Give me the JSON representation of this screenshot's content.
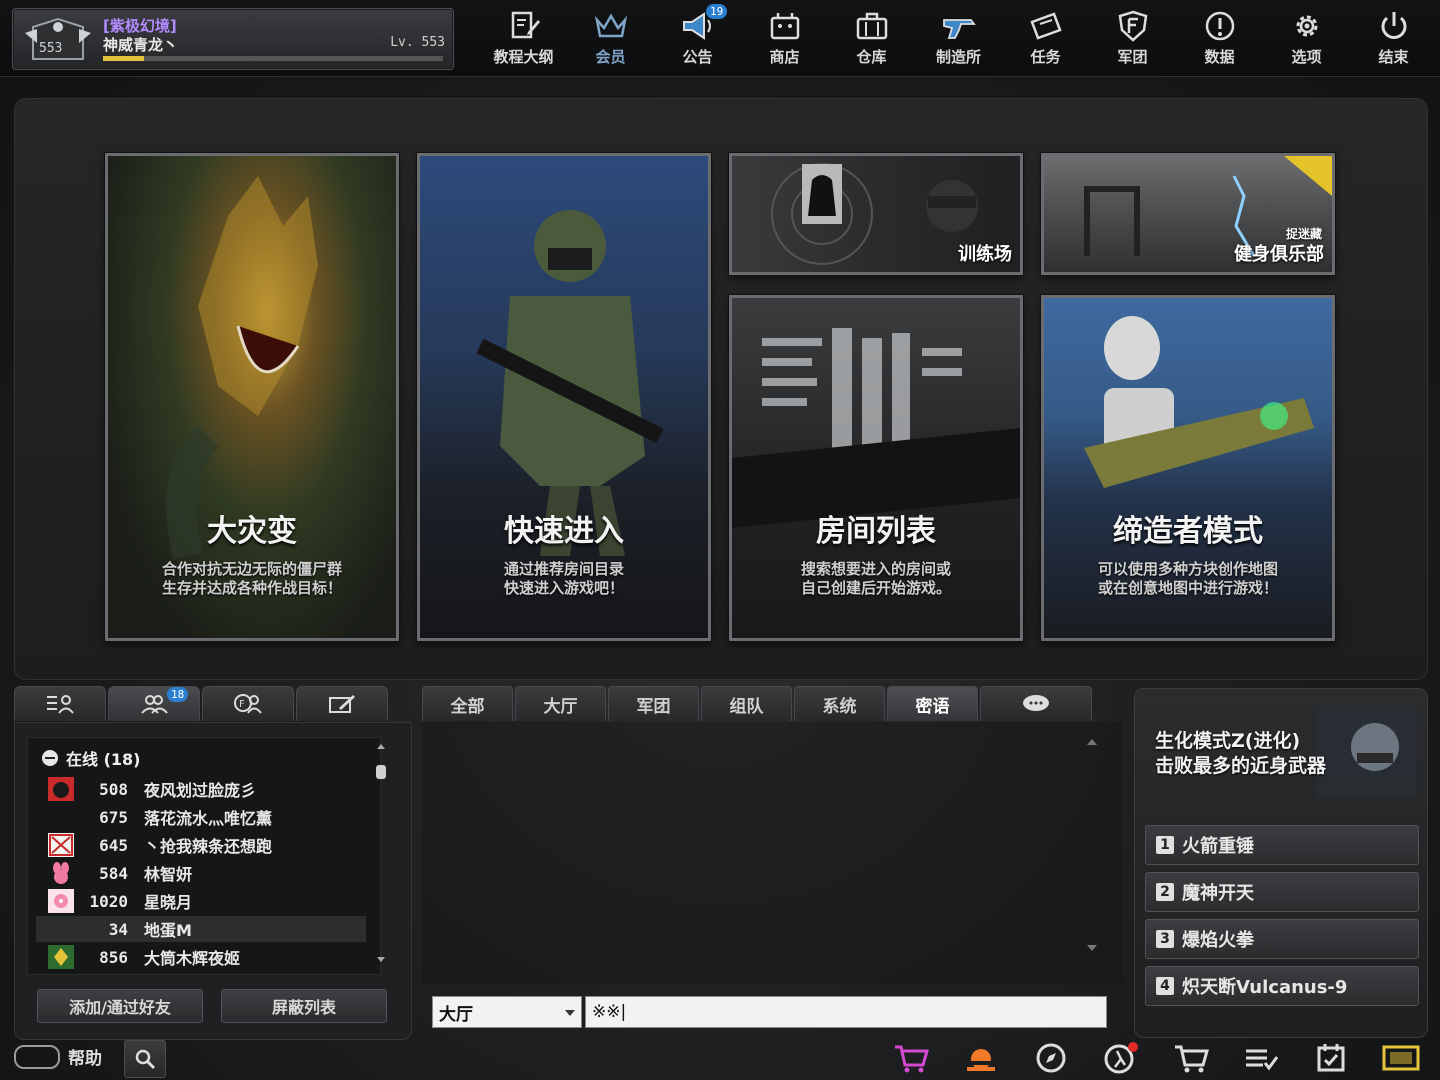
{
  "profile": {
    "rank_number": "553",
    "clan_tag": "[紫极幻境]",
    "name": "神威青龙丶",
    "level": "Lv. 553",
    "xp_progress": 0.12
  },
  "menu": [
    {
      "label": "教程大纲",
      "icon": "notebook-edit-icon"
    },
    {
      "label": "会员",
      "icon": "crown-icon"
    },
    {
      "label": "公告",
      "icon": "megaphone-icon",
      "badge": "19"
    },
    {
      "label": "商店",
      "icon": "store-icon"
    },
    {
      "label": "仓库",
      "icon": "briefcase-icon"
    },
    {
      "label": "制造所",
      "icon": "gun-icon"
    },
    {
      "label": "任务",
      "icon": "ticket-icon"
    },
    {
      "label": "军团",
      "icon": "clan-shield-icon"
    },
    {
      "label": "数据",
      "icon": "info-icon"
    },
    {
      "label": "选项",
      "icon": "gear-icon"
    },
    {
      "label": "结束",
      "icon": "power-icon"
    }
  ],
  "cards": {
    "disaster": {
      "title": "大灾变",
      "desc1": "合作对抗无边无际的僵尸群",
      "desc2": "生存并达成各种作战目标！"
    },
    "quick": {
      "title": "快速进入",
      "desc1": "通过推荐房间目录",
      "desc2": "快速进入游戏吧！"
    },
    "training": {
      "title": "训练场"
    },
    "gym": {
      "title": "健身俱乐部",
      "tag": "捉迷藏"
    },
    "rooms": {
      "title": "房间列表",
      "desc1": "搜索想要进入的房间或",
      "desc2": "自己创建后开始游戏。"
    },
    "creator": {
      "title": "缔造者模式",
      "desc1": "可以使用多种方块创作地图",
      "desc2": "或在创意地图中进行游戏！"
    }
  },
  "friend_tabs": [
    {
      "icon": "list-user-icon"
    },
    {
      "icon": "friends-icon",
      "badge": "18"
    },
    {
      "icon": "clan-friends-icon"
    },
    {
      "icon": "edit-note-icon"
    }
  ],
  "friends": {
    "header": "在线 (18)",
    "rows": [
      {
        "level": "508",
        "name": "夜风划过脸庞彡",
        "icon": "red-clan-emblem-icon"
      },
      {
        "level": "675",
        "name": "落花流水灬唯忆薰",
        "icon": ""
      },
      {
        "level": "645",
        "name": "丶抢我辣条还想跑",
        "icon": "red-x-emblem-icon"
      },
      {
        "level": "584",
        "name": "林智妍",
        "icon": "pink-rabbit-emblem-icon"
      },
      {
        "level": "1020",
        "name": "星晓月",
        "icon": "sakura-emblem-icon"
      },
      {
        "level": "34",
        "name": "地蛋M",
        "icon": ""
      },
      {
        "level": "856",
        "name": "大筒木辉夜姬",
        "icon": "green-leaf-emblem-icon"
      }
    ],
    "add_button": "添加/通过好友",
    "block_button": "屏蔽列表"
  },
  "chat": {
    "tabs": [
      "全部",
      "大厅",
      "军团",
      "组队",
      "系统",
      "密语"
    ],
    "active_tab": "密语",
    "channel": "大厅",
    "input_value": "※※|"
  },
  "mode_panel": {
    "title_line1": "生化模式Z(进化)",
    "title_line2": "击败最多的近身武器",
    "weapons": [
      {
        "num": "1",
        "name": "火箭重锤"
      },
      {
        "num": "2",
        "name": "魔神开天"
      },
      {
        "num": "3",
        "name": "爆焰火拳"
      },
      {
        "num": "4",
        "name": "炽天断Vulcanus-9"
      }
    ]
  },
  "bottom": {
    "help_label": "帮助",
    "icons": [
      "cart-plus-icon",
      "sun-event-icon",
      "compass-icon",
      "runner-alert-icon",
      "shop-cart-icon",
      "checklist-icon",
      "calendar-check-icon",
      "film-icon"
    ]
  },
  "colors": {
    "accent_blue": "#2b7fd0",
    "clan_purple": "#b28cff",
    "xp_yellow": "#e3c43a"
  }
}
